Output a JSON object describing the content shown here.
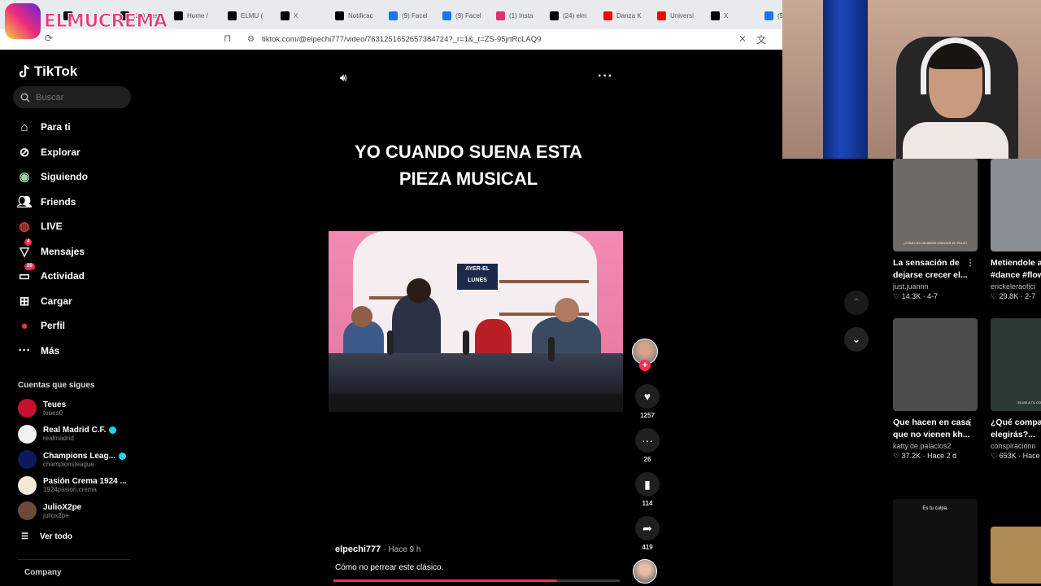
{
  "browser": {
    "tabs": [
      {
        "label": "",
        "color": "#000000"
      },
      {
        "label": "(24) Res",
        "color": "#000000"
      },
      {
        "label": "Home /",
        "color": "#000000"
      },
      {
        "label": "ELMU (",
        "color": "#000000"
      },
      {
        "label": "X",
        "color": "#000000"
      },
      {
        "label": "Notificac",
        "color": "#000000"
      },
      {
        "label": "(9) Facel",
        "color": "#1877f2"
      },
      {
        "label": "(9) Facel",
        "color": "#1877f2"
      },
      {
        "label": "(1) Insta",
        "color": "#e1306c"
      },
      {
        "label": "(24) elm",
        "color": "#000000"
      },
      {
        "label": "Danza K",
        "color": "#ff0000"
      },
      {
        "label": "Universi",
        "color": "#ff0000"
      },
      {
        "label": "X",
        "color": "#000000"
      },
      {
        "label": "(9",
        "color": "#1877f2"
      }
    ],
    "url": "tiktok.com/@elpechi777/video/7631251652657384724?_r=1&_t=ZS-95jrtRcLAQ9"
  },
  "watermark": {
    "text": "ELMUCREMA"
  },
  "sidebar": {
    "brand": "TikTok",
    "search_placeholder": "Buscar",
    "nav": [
      {
        "label": "Para ti",
        "icon": "home-icon"
      },
      {
        "label": "Explorar",
        "icon": "compass-icon"
      },
      {
        "label": "Siguiendo",
        "icon": "following-icon"
      },
      {
        "label": "Friends",
        "icon": "friends-icon"
      },
      {
        "label": "LIVE",
        "icon": "live-icon"
      },
      {
        "label": "Mensajes",
        "icon": "messages-icon",
        "badge": "4"
      },
      {
        "label": "Actividad",
        "icon": "activity-icon",
        "badge": "20"
      },
      {
        "label": "Cargar",
        "icon": "upload-icon"
      },
      {
        "label": "Perfil",
        "icon": "profile-icon"
      },
      {
        "label": "Más",
        "icon": "more-icon"
      }
    ],
    "following_title": "Cuentas que sigues",
    "following": [
      {
        "name": "Teues",
        "handle": "teues0",
        "verified": false,
        "color": "#c8102e"
      },
      {
        "name": "Real Madrid C.F.",
        "handle": "realmadrid",
        "verified": true,
        "color": "#f2f2f2"
      },
      {
        "name": "Champions Leag...",
        "handle": "championsleague",
        "verified": true,
        "color": "#0a1a5c"
      },
      {
        "name": "Pasión Crema 1924 ...",
        "handle": "1924pasion.crema",
        "verified": false,
        "color": "#f4e9d8"
      },
      {
        "name": "JulioX2pe",
        "handle": "juliox2pe",
        "verified": false,
        "color": "#6b4a3a"
      }
    ],
    "see_all": "Ver todo",
    "company": "Company"
  },
  "video": {
    "overlay_text": "YO CUANDO SUENA ESTA PIEZA MUSICAL",
    "sign_text": "AYER-EL LUNES",
    "author": "elpechi777",
    "time": "· Hace 9 h",
    "description": "Cómo no perrear este clásico.",
    "progress": 0.78,
    "counts": {
      "likes": "1257",
      "comments": "26",
      "saves": "114",
      "shares": "419"
    }
  },
  "recommended": [
    {
      "title": "La sensación de dejarse crecer el...",
      "handle": "just.juannn",
      "meta": "♡ 14.3K · 4-7",
      "thumb": "#6f6a66"
    },
    {
      "title": "Metiendole a #dance #flow",
      "handle": "erickeleraofici",
      "meta": "♡ 29.8K · 2-7",
      "thumb": "#8a8f96"
    },
    {
      "title": "Que hacen en casa que no vienen kh...",
      "handle": "katty.de.palacios2",
      "meta": "♡ 37.2K · Hace 2 d",
      "thumb": "#4a4f4c"
    },
    {
      "title": "¿Qué compa elegirás?...",
      "handle": "conspiracionn",
      "meta": "♡ 653K · Hace",
      "thumb": "#2d3a33"
    },
    {
      "title": "",
      "handle": "",
      "meta": "",
      "thumb": "#111111",
      "caption": "Es tu culpa."
    },
    {
      "title": "",
      "handle": "",
      "meta": "",
      "thumb": "#b08a55"
    }
  ],
  "thumb_captions": {
    "r0": "¿CÓMO ES DEJARSE CRECER EL PELO?",
    "r3": "ELIGE A TU COMPA"
  }
}
